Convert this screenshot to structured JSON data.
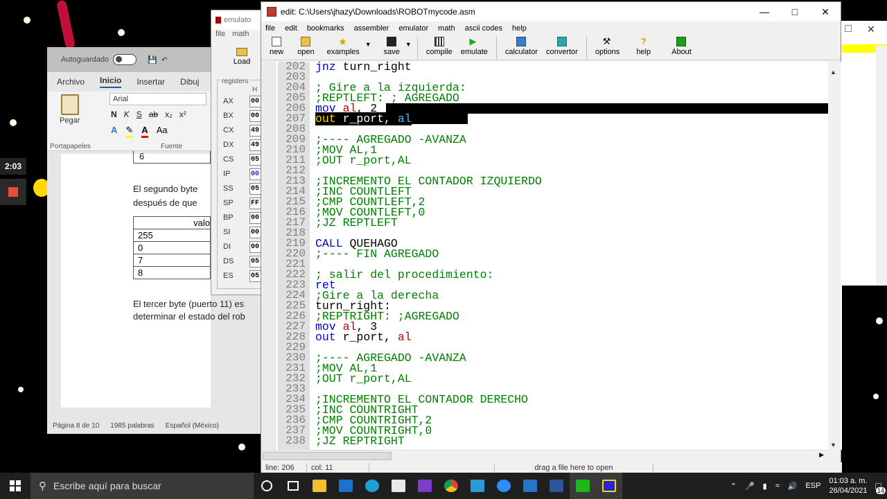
{
  "video": {
    "time": "2:03"
  },
  "word": {
    "autosave_label": "Autoguardado",
    "tabs": [
      "Archivo",
      "Inicio",
      "Insertar",
      "Dibuj"
    ],
    "font_name": "Arial",
    "paste_label": "Pegar",
    "clipboard_group": "Portapapeles",
    "font_group": "Fuente",
    "doc_lines": {
      "cell_6": "6",
      "p1_line1": "El segundo byte",
      "p1_line2": "después de que",
      "table_header": "valo",
      "table_values": [
        "255",
        "0",
        "7",
        "8"
      ],
      "p2_line1": "El tercer byte (puerto 11) es",
      "p2_line2": "determinar el estado del rob"
    },
    "status": {
      "page": "Página 8 de 10",
      "words": "1985 palabras",
      "language": "Español (México)"
    }
  },
  "emulator_small": {
    "title": "emulato",
    "menu": [
      "file",
      "math"
    ],
    "load_label": "Load",
    "registers_title": "registers",
    "h_header": "H",
    "registers": [
      {
        "name": "AX",
        "value": "00"
      },
      {
        "name": "BX",
        "value": "00"
      },
      {
        "name": "CX",
        "value": "49"
      },
      {
        "name": "DX",
        "value": "49"
      },
      {
        "name": "CS",
        "value": "05"
      },
      {
        "name": "IP",
        "value": "00"
      },
      {
        "name": "SS",
        "value": "05"
      },
      {
        "name": "SP",
        "value": "FF"
      },
      {
        "name": "BP",
        "value": "00"
      },
      {
        "name": "SI",
        "value": "00"
      },
      {
        "name": "DI",
        "value": "00"
      },
      {
        "name": "DS",
        "value": "05"
      },
      {
        "name": "ES",
        "value": "05"
      }
    ]
  },
  "editor": {
    "title": "edit: C:\\Users\\jhazy\\Downloads\\ROBOTmycode.asm",
    "menu": [
      "file",
      "edit",
      "bookmarks",
      "assembler",
      "emulator",
      "math",
      "ascii codes",
      "help"
    ],
    "toolbar": [
      "new",
      "open",
      "examples",
      "save",
      "compile",
      "emulate",
      "calculator",
      "convertor",
      "options",
      "help",
      "About"
    ],
    "code_lines": [
      {
        "n": "202",
        "parts": [
          [
            "kw",
            "jnz "
          ],
          [
            "tx",
            "turn_right"
          ]
        ]
      },
      {
        "n": "203",
        "parts": []
      },
      {
        "n": "204",
        "parts": [
          [
            "cm",
            "; Gire a la izquierda:"
          ]
        ]
      },
      {
        "n": "205",
        "parts": [
          [
            "cm",
            ";REPTLEFT: ; AGREGADO"
          ]
        ]
      },
      {
        "n": "206",
        "parts": [
          [
            "kw",
            "mov "
          ],
          [
            "reg2",
            "al"
          ],
          [
            "tx",
            ", 2"
          ]
        ]
      },
      {
        "n": "207",
        "parts": [
          [
            "kw",
            "out "
          ],
          [
            "tx",
            "r_port, "
          ],
          [
            "reg2",
            "al"
          ]
        ]
      },
      {
        "n": "208",
        "parts": []
      },
      {
        "n": "209",
        "parts": [
          [
            "cm",
            ";---- AGREGADO -AVANZA"
          ]
        ]
      },
      {
        "n": "210",
        "parts": [
          [
            "cm",
            ";MOV AL,1"
          ]
        ]
      },
      {
        "n": "211",
        "parts": [
          [
            "cm",
            ";OUT r_port,AL"
          ]
        ]
      },
      {
        "n": "212",
        "parts": []
      },
      {
        "n": "213",
        "parts": [
          [
            "cm",
            ";INCREMENTO EL CONTADOR IZQUIERDO"
          ]
        ]
      },
      {
        "n": "214",
        "parts": [
          [
            "cm",
            ";INC COUNTLEFT"
          ]
        ]
      },
      {
        "n": "215",
        "parts": [
          [
            "cm",
            ";CMP COUNTLEFT,2"
          ]
        ]
      },
      {
        "n": "216",
        "parts": [
          [
            "cm",
            ";MOV COUNTLEFT,0"
          ]
        ]
      },
      {
        "n": "217",
        "parts": [
          [
            "cm",
            ";JZ REPTLEFT"
          ]
        ]
      },
      {
        "n": "218",
        "parts": []
      },
      {
        "n": "219",
        "parts": [
          [
            "kw",
            "CALL "
          ],
          [
            "tx",
            "QUEHAGO"
          ]
        ]
      },
      {
        "n": "220",
        "parts": [
          [
            "cm",
            ";---- FIN AGREGADO"
          ]
        ]
      },
      {
        "n": "221",
        "parts": []
      },
      {
        "n": "222",
        "parts": [
          [
            "cm",
            "; salir del procedimiento:"
          ]
        ]
      },
      {
        "n": "223",
        "parts": [
          [
            "kw",
            "ret"
          ]
        ]
      },
      {
        "n": "224",
        "parts": [
          [
            "cm",
            ";Gire a la derecha"
          ]
        ]
      },
      {
        "n": "225",
        "parts": [
          [
            "tx",
            "turn_right:"
          ]
        ]
      },
      {
        "n": "226",
        "parts": [
          [
            "cm",
            ";REPTRIGHT: ;AGREGADO"
          ]
        ]
      },
      {
        "n": "227",
        "parts": [
          [
            "kw",
            "mov "
          ],
          [
            "reg2",
            "al"
          ],
          [
            "tx",
            ", 3"
          ]
        ]
      },
      {
        "n": "228",
        "parts": [
          [
            "kw",
            "out "
          ],
          [
            "tx",
            "r_port, "
          ],
          [
            "reg2",
            "al"
          ]
        ]
      },
      {
        "n": "229",
        "parts": []
      },
      {
        "n": "230",
        "parts": [
          [
            "cm",
            ";---- AGREGADO -AVANZA"
          ]
        ]
      },
      {
        "n": "231",
        "parts": [
          [
            "cm",
            ";MOV AL,1"
          ]
        ]
      },
      {
        "n": "232",
        "parts": [
          [
            "cm",
            ";OUT r_port,AL"
          ]
        ]
      },
      {
        "n": "233",
        "parts": []
      },
      {
        "n": "234",
        "parts": [
          [
            "cm",
            ";INCREMENTO EL CONTADOR DERECHO"
          ]
        ]
      },
      {
        "n": "235",
        "parts": [
          [
            "cm",
            ";INC COUNTRIGHT"
          ]
        ]
      },
      {
        "n": "236",
        "parts": [
          [
            "cm",
            ";CMP COUNTRIGHT,2"
          ]
        ]
      },
      {
        "n": "237",
        "parts": [
          [
            "cm",
            ";MOV COUNTRIGHT,0"
          ]
        ]
      },
      {
        "n": "238",
        "parts": [
          [
            "cm",
            ";JZ REPTRIGHT"
          ]
        ]
      }
    ],
    "status": {
      "line": "line: 206",
      "col": "col: 11",
      "hint": "drag a file here to open"
    }
  },
  "taskbar": {
    "search_placeholder": "Escribe aquí para buscar",
    "language": "ESP",
    "time": "01:03 a. m.",
    "date": "26/04/2021",
    "notification_count": "14"
  },
  "colors": {
    "keyword": "#0000c8",
    "register": "#c00000",
    "comment": "#008000",
    "selection": "#000000"
  }
}
